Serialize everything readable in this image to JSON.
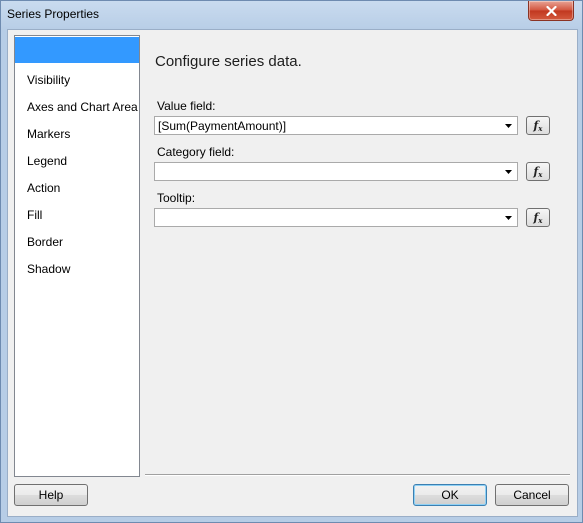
{
  "window": {
    "title": "Series Properties"
  },
  "nav": {
    "items": [
      {
        "label": ""
      },
      {
        "label": "Visibility"
      },
      {
        "label": "Axes and Chart Area"
      },
      {
        "label": "Markers"
      },
      {
        "label": "Legend"
      },
      {
        "label": "Action"
      },
      {
        "label": "Fill"
      },
      {
        "label": "Border"
      },
      {
        "label": "Shadow"
      }
    ],
    "selected_index": 0
  },
  "main": {
    "heading": "Configure series data.",
    "value_field": {
      "label": "Value field:",
      "value": "[Sum(PaymentAmount)]"
    },
    "category_field": {
      "label": "Category field:",
      "value": ""
    },
    "tooltip": {
      "label": "Tooltip:",
      "value": ""
    },
    "fx_icon": "function-fx-icon"
  },
  "footer": {
    "help_label": "Help",
    "ok_label": "OK",
    "cancel_label": "Cancel"
  },
  "colors": {
    "selection": "#3399ff",
    "close_button": "#c7432a"
  }
}
